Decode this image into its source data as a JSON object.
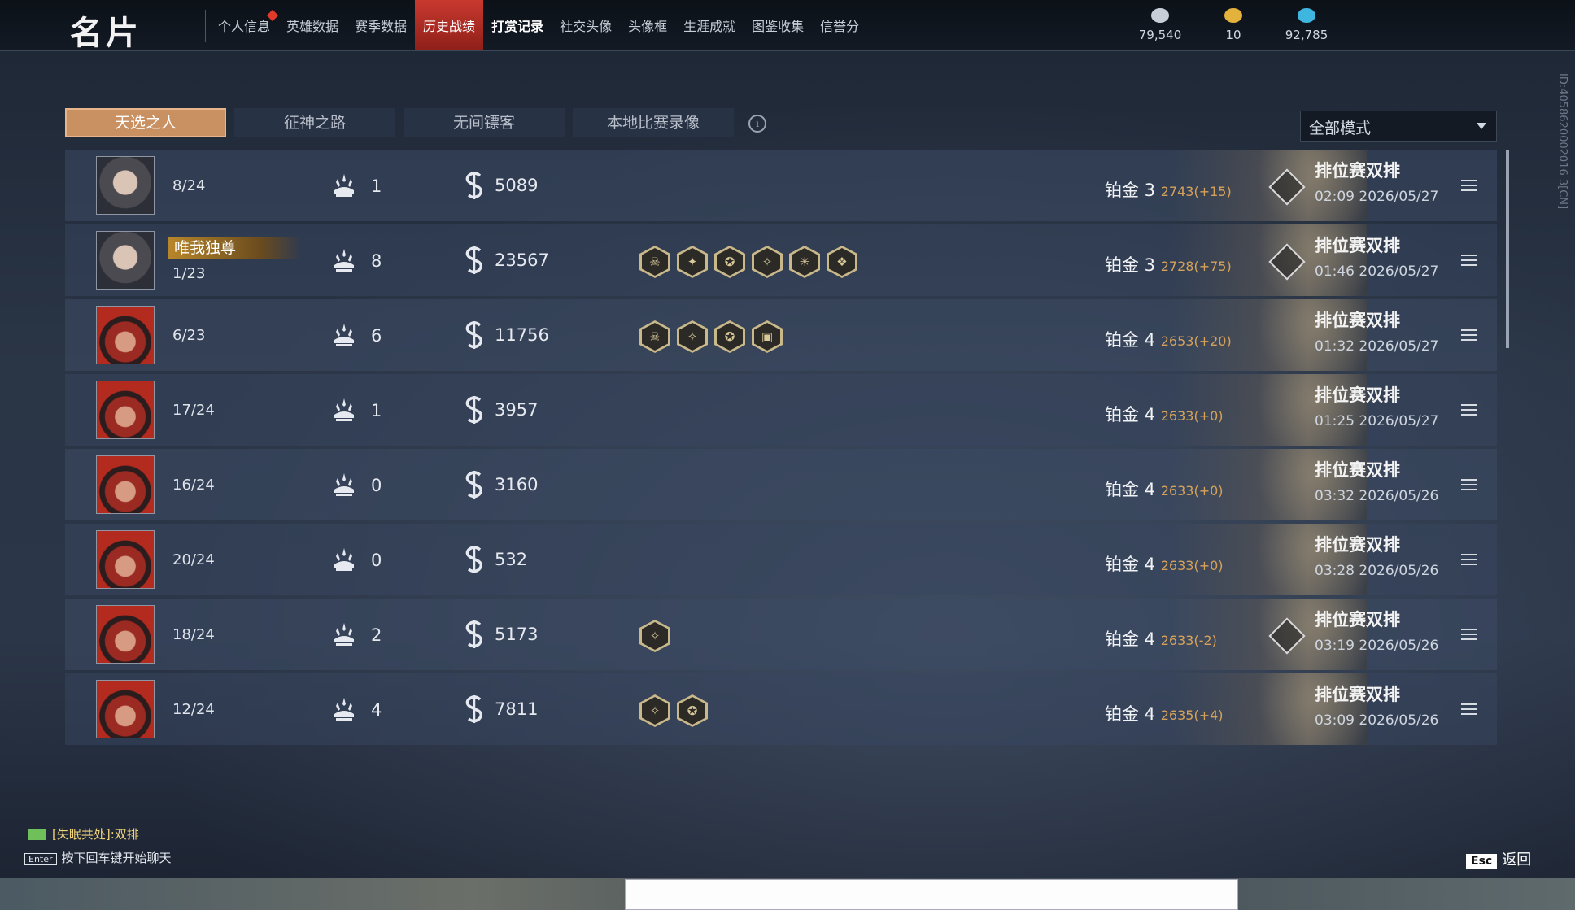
{
  "header": {
    "title": "名片",
    "nav": [
      {
        "label": "个人信息",
        "has_alert": true
      },
      {
        "label": "英雄数据"
      },
      {
        "label": "赛季数据"
      },
      {
        "label": "历史战绩",
        "active": true
      },
      {
        "label": "打赏记录",
        "bold": true
      },
      {
        "label": "社交头像"
      },
      {
        "label": "头像框"
      },
      {
        "label": "生涯成就"
      },
      {
        "label": "图鉴收集"
      },
      {
        "label": "信誉分"
      }
    ],
    "currencies": [
      {
        "icon": "coin-icon",
        "value": "79,540",
        "color": "#c8ced8"
      },
      {
        "icon": "ticket-icon",
        "value": "10",
        "color": "#e3b23c"
      },
      {
        "icon": "feather-icon",
        "value": "92,785",
        "color": "#3fb6e0"
      }
    ]
  },
  "side_id": "ID:4058620002016 3[CN]",
  "tabs": [
    "天选之人",
    "征神之路",
    "无间镖客",
    "本地比赛录像"
  ],
  "mode_select": {
    "value": "全部模式"
  },
  "matches": [
    {
      "avatar": "female",
      "title": "",
      "rank": "8/24",
      "kills": "1",
      "score": "5089",
      "badges": [],
      "tier": "铂金 3",
      "points": "2743(+15)",
      "bar_icon": true,
      "mode": "排位赛双排",
      "time": "02:09  2026/05/27"
    },
    {
      "avatar": "female",
      "title": "唯我独尊",
      "rank": "1/23",
      "kills": "8",
      "score": "23567",
      "badges": [
        "☠",
        "✦",
        "✪",
        "✧",
        "✳",
        "❖"
      ],
      "tier": "铂金 3",
      "points": "2728(+75)",
      "bar_icon": true,
      "mode": "排位赛双排",
      "time": "01:46  2026/05/27"
    },
    {
      "avatar": "male",
      "title": "",
      "rank": "6/23",
      "kills": "6",
      "score": "11756",
      "badges": [
        "☠",
        "✧",
        "✪",
        "▣"
      ],
      "tier": "铂金 4",
      "points": "2653(+20)",
      "bar_icon": false,
      "mode": "排位赛双排",
      "time": "01:32  2026/05/27"
    },
    {
      "avatar": "male",
      "title": "",
      "rank": "17/24",
      "kills": "1",
      "score": "3957",
      "badges": [],
      "tier": "铂金 4",
      "points": "2633(+0)",
      "bar_icon": false,
      "mode": "排位赛双排",
      "time": "01:25  2026/05/27"
    },
    {
      "avatar": "male",
      "title": "",
      "rank": "16/24",
      "kills": "0",
      "score": "3160",
      "badges": [],
      "tier": "铂金 4",
      "points": "2633(+0)",
      "bar_icon": false,
      "mode": "排位赛双排",
      "time": "03:32  2026/05/26"
    },
    {
      "avatar": "male",
      "title": "",
      "rank": "20/24",
      "kills": "0",
      "score": "532",
      "badges": [],
      "tier": "铂金 4",
      "points": "2633(+0)",
      "bar_icon": false,
      "mode": "排位赛双排",
      "time": "03:28  2026/05/26"
    },
    {
      "avatar": "male",
      "title": "",
      "rank": "18/24",
      "kills": "2",
      "score": "5173",
      "badges": [
        "✧"
      ],
      "tier": "铂金 4",
      "points": "2633(-2)",
      "bar_icon": true,
      "mode": "排位赛双排",
      "time": "03:19  2026/05/26"
    },
    {
      "avatar": "male",
      "title": "",
      "rank": "12/24",
      "kills": "4",
      "score": "7811",
      "badges": [
        "✧",
        "✪"
      ],
      "tier": "铂金 4",
      "points": "2635(+4)",
      "bar_icon": false,
      "mode": "排位赛双排",
      "time": "03:09  2026/05/26"
    }
  ],
  "chat": {
    "status": "[失眠共处]:双排",
    "enter_key": "Enter",
    "hint": "按下回车键开始聊天"
  },
  "back": {
    "key": "Esc",
    "label": "返回"
  }
}
